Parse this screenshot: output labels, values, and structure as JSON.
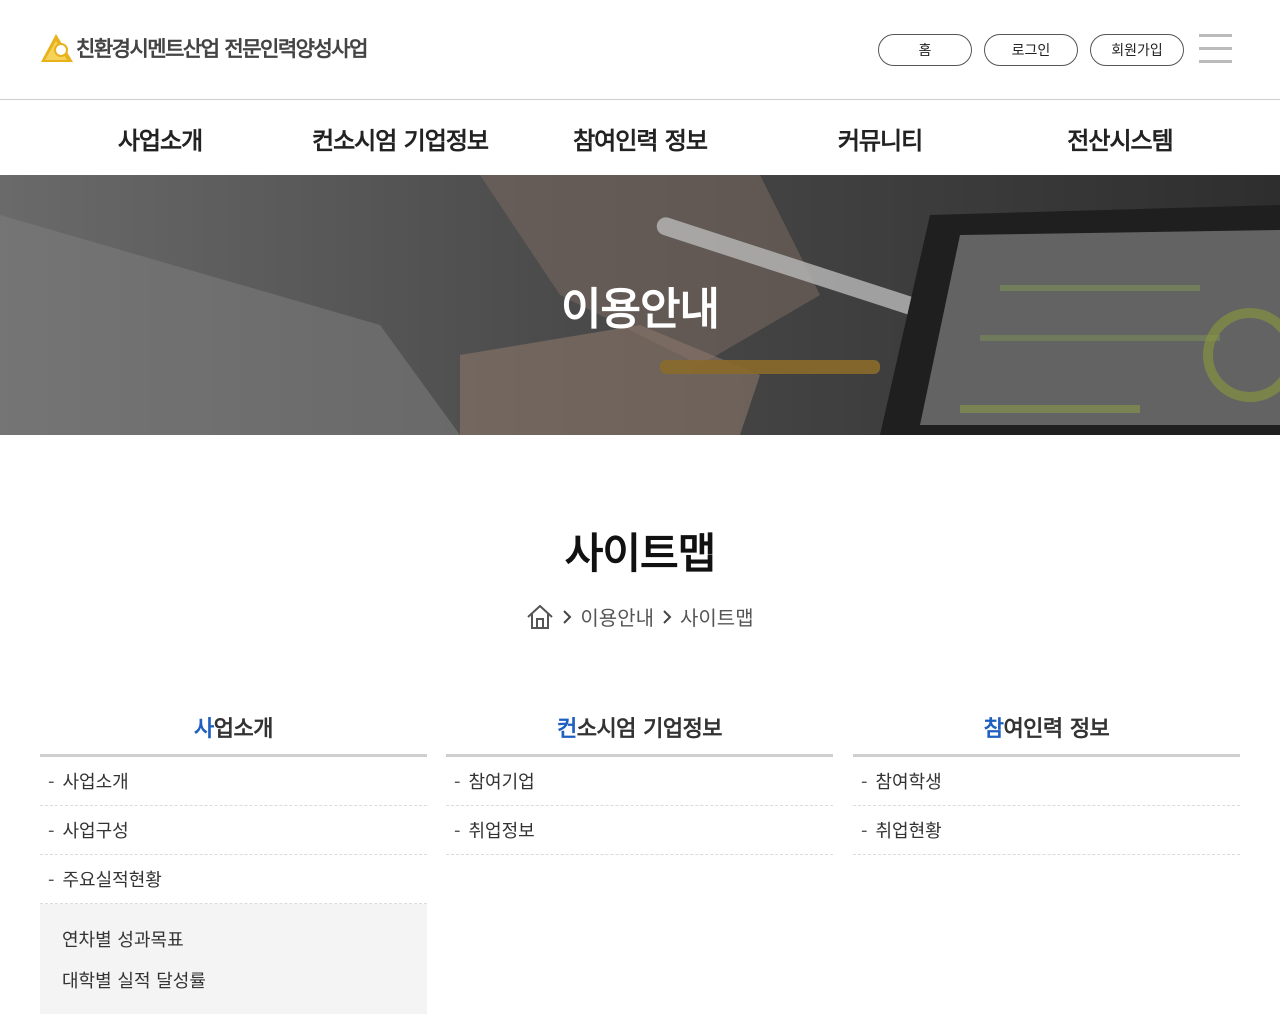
{
  "header": {
    "logo_text": "친환경시멘트산업 전문인력양성사업",
    "top_buttons": [
      "홈",
      "로그인",
      "회원가입"
    ]
  },
  "gnb": [
    "사업소개",
    "컨소시엄 기업정보",
    "참여인력 정보",
    "커뮤니티",
    "전산시스템"
  ],
  "visual": {
    "title": "이용안내"
  },
  "page": {
    "title": "사이트맵",
    "breadcrumb": [
      "이용안내",
      "사이트맵"
    ]
  },
  "sitemap": [
    {
      "first": "사",
      "rest": "업소개",
      "items": [
        "사업소개",
        "사업구성",
        "주요실적현황"
      ],
      "sub_items": [
        "연차별 성과목표",
        "대학별 실적 달성률"
      ]
    },
    {
      "first": "컨",
      "rest": "소시엄 기업정보",
      "items": [
        "참여기업",
        "취업정보"
      ]
    },
    {
      "first": "참",
      "rest": "여인력 정보",
      "items": [
        "참여학생",
        "취업현황"
      ]
    }
  ],
  "colors": {
    "accent": "#1f5fbf",
    "logo": "#e8b21c"
  },
  "icons": [
    "logo-icon",
    "menu-icon",
    "home-icon",
    "chevron-right-icon"
  ]
}
